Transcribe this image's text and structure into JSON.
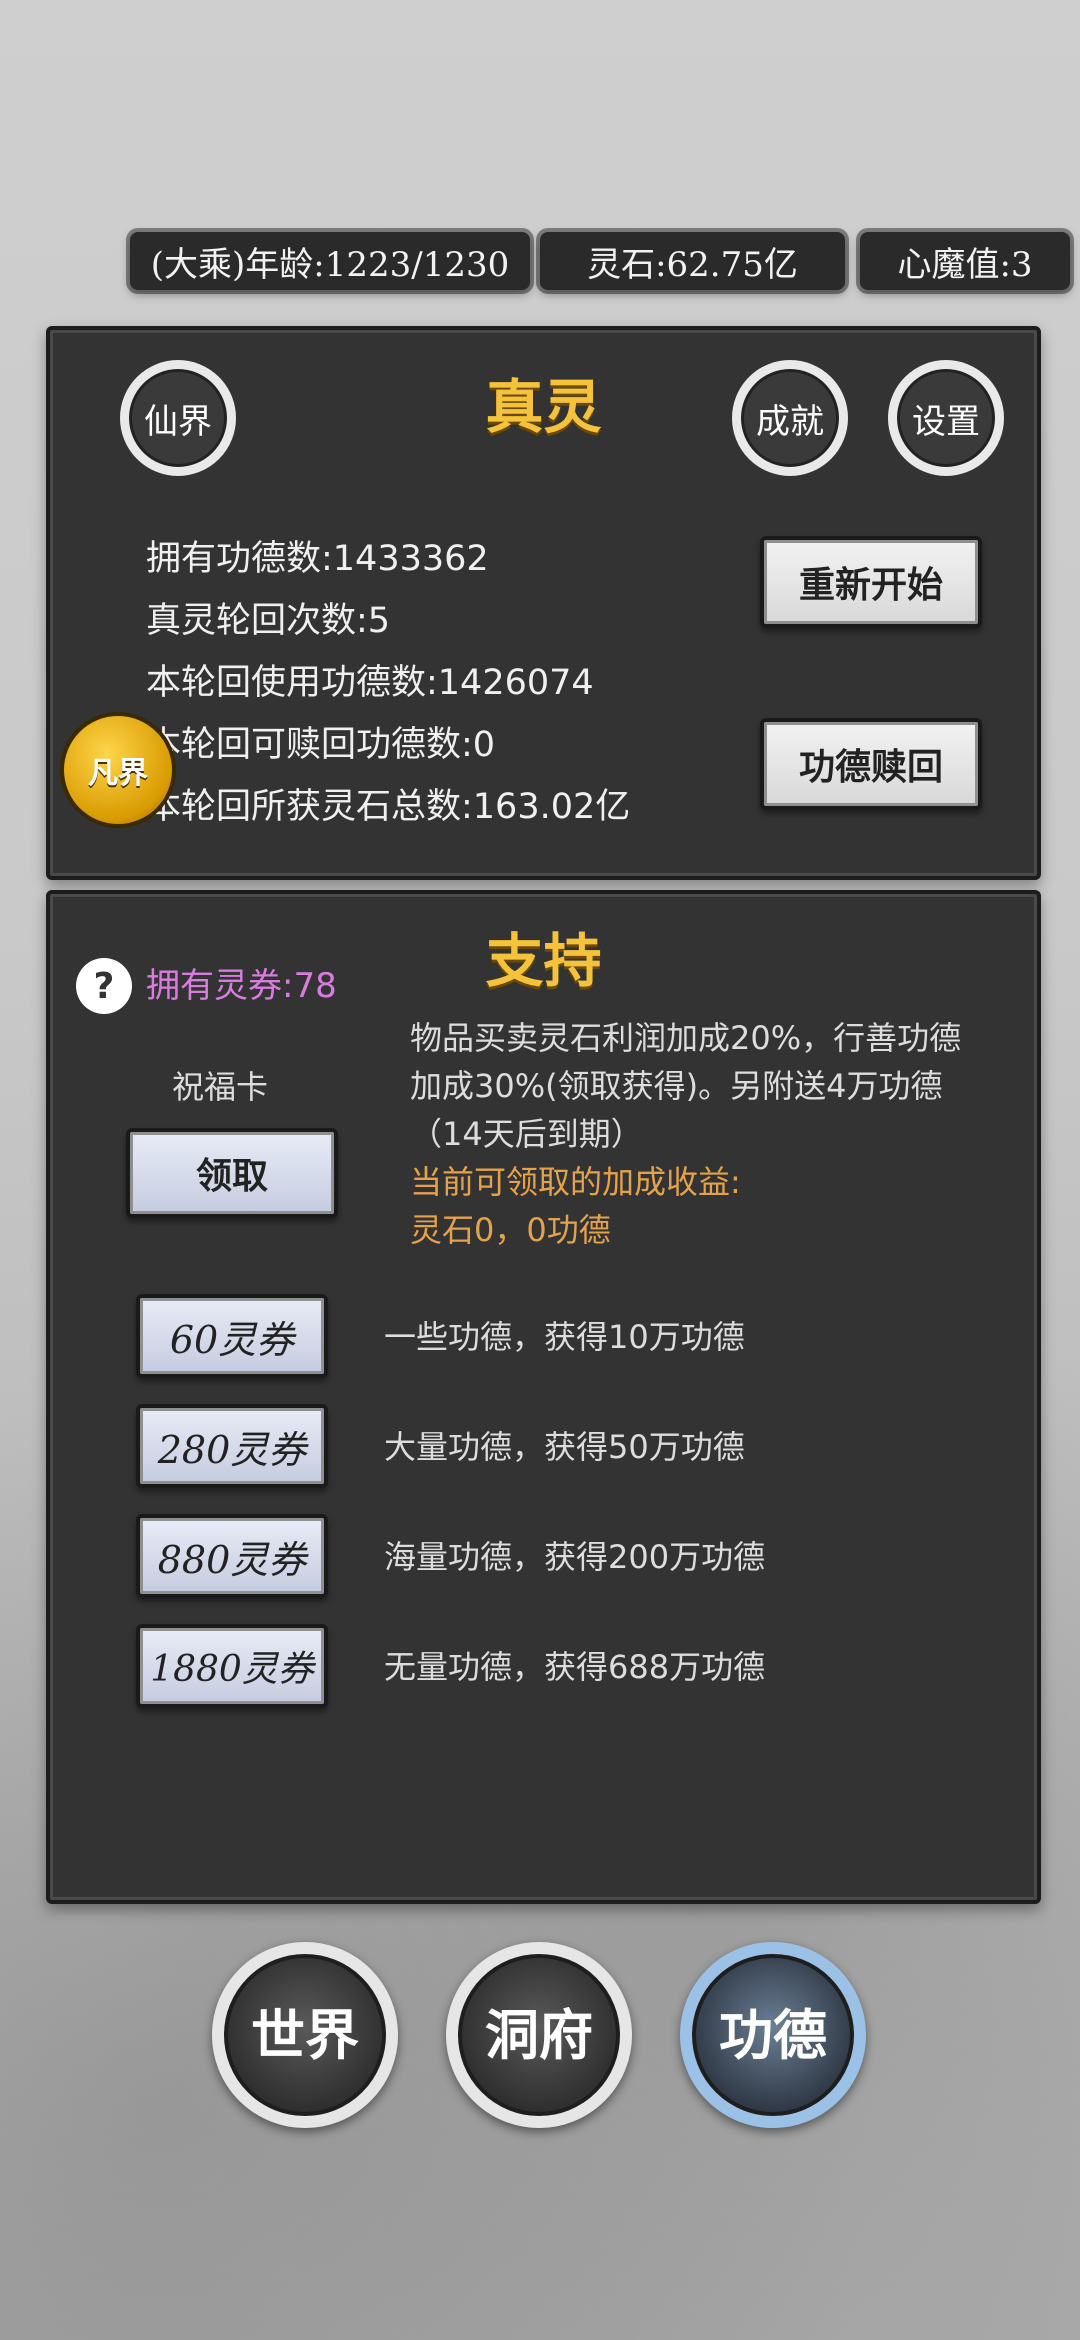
{
  "status_bar": {
    "age": "(大乘)年龄:1223/1230",
    "spirit_stone": "灵石:62.75亿",
    "heart_demon": "心魔值:3"
  },
  "top_panel": {
    "title": "真灵",
    "immortal_realm_button": "仙界",
    "achievement_button": "成就",
    "settings_button": "设置",
    "stats": [
      "拥有功德数:1433362",
      "真灵轮回次数:5",
      "本轮回使用功德数:1426074",
      "本轮回可赎回功德数:0",
      "本轮回所获灵石总数:163.02亿"
    ],
    "restart_button": "重新开始",
    "redeem_button": "功德赎回",
    "side_badge": "凡界"
  },
  "support_panel": {
    "title": "支持",
    "help_icon": "?",
    "coupons_owned": "拥有灵券:78",
    "blessing_card_label": "祝福卡",
    "claim_button": "领取",
    "description": "物品买卖灵石利润加成20%，行善功德加成30%(领取获得)。另附送4万功德（14天后到期）",
    "current_bonus_title": "当前可领取的加成收益:",
    "current_bonus_value": "灵石0，0功德",
    "purchase_options": [
      {
        "price": "60灵券",
        "desc": "一些功德，获得10万功德"
      },
      {
        "price": "280灵券",
        "desc": "大量功德，获得50万功德"
      },
      {
        "price": "880灵券",
        "desc": "海量功德，获得200万功德"
      },
      {
        "price": "1880灵券",
        "desc": "无量功德，获得688万功德"
      }
    ]
  },
  "bottom_nav": {
    "world": "世界",
    "cave": "洞府",
    "merit": "功德",
    "active_tab": "merit"
  },
  "colors": {
    "gold_title": "#f5c23c",
    "coupon_purple": "#d87ddf",
    "bonus_orange": "#e6a24a"
  }
}
